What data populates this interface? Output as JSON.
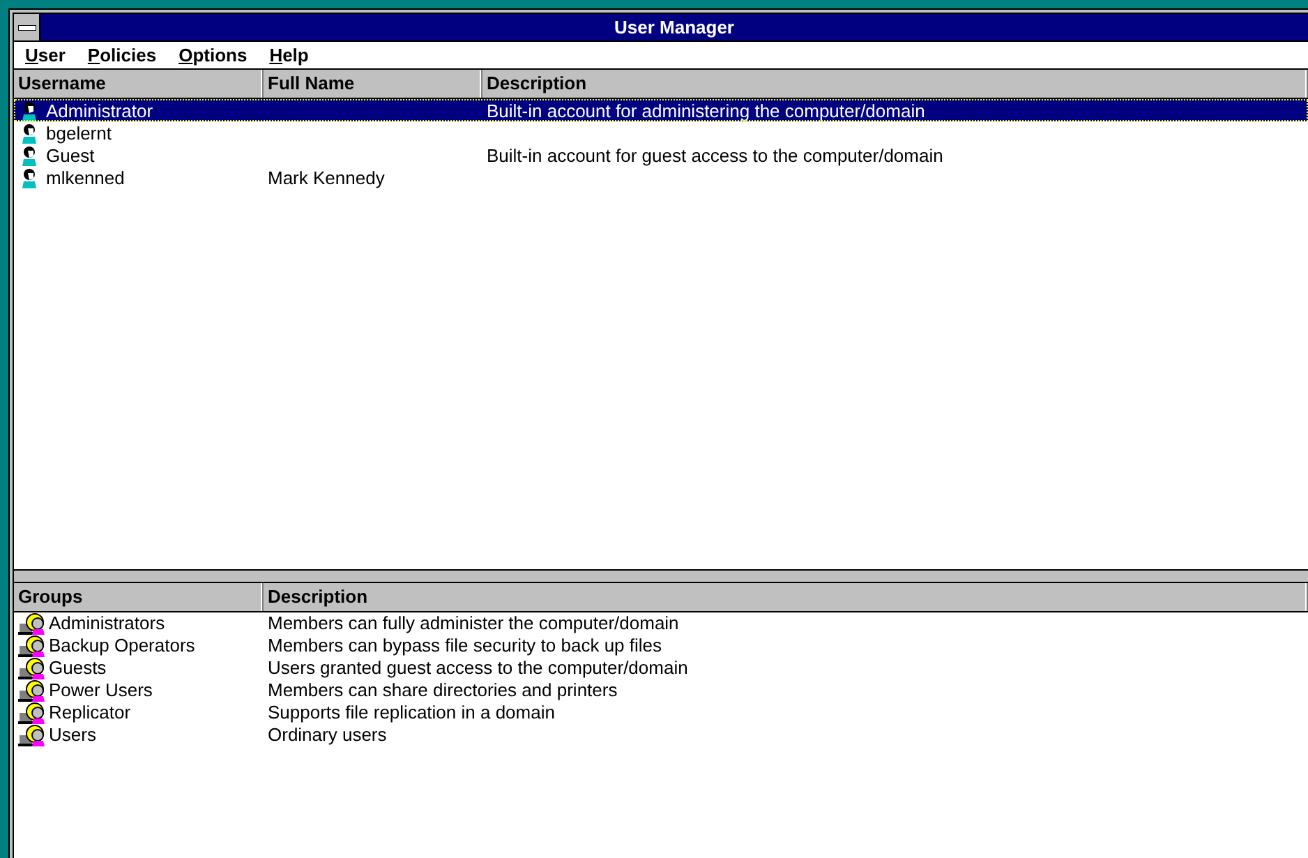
{
  "window": {
    "title": "User Manager"
  },
  "menu": [
    "User",
    "Policies",
    "Options",
    "Help"
  ],
  "users": {
    "columns": [
      "Username",
      "Full Name",
      "Description"
    ],
    "rows": [
      {
        "username": "Administrator",
        "full_name": "",
        "description": "Built-in account for administering the computer/domain",
        "selected": true
      },
      {
        "username": "bgelernt",
        "full_name": "",
        "description": "",
        "selected": false
      },
      {
        "username": "Guest",
        "full_name": "",
        "description": "Built-in account for guest access to the computer/domain",
        "selected": false
      },
      {
        "username": "mlkenned",
        "full_name": "Mark Kennedy",
        "description": "",
        "selected": false
      }
    ]
  },
  "groups": {
    "columns": [
      "Groups",
      "Description"
    ],
    "rows": [
      {
        "name": "Administrators",
        "description": "Members can fully administer the computer/domain",
        "selected": false
      },
      {
        "name": "Backup Operators",
        "description": "Members can bypass file security to back up files",
        "selected": false
      },
      {
        "name": "Guests",
        "description": "Users granted guest access to the computer/domain",
        "selected": false
      },
      {
        "name": "Power Users",
        "description": "Members can share directories and printers",
        "selected": false
      },
      {
        "name": "Replicator",
        "description": "Supports file replication in a domain",
        "selected": false
      },
      {
        "name": "Users",
        "description": "Ordinary users",
        "selected": false
      }
    ]
  }
}
